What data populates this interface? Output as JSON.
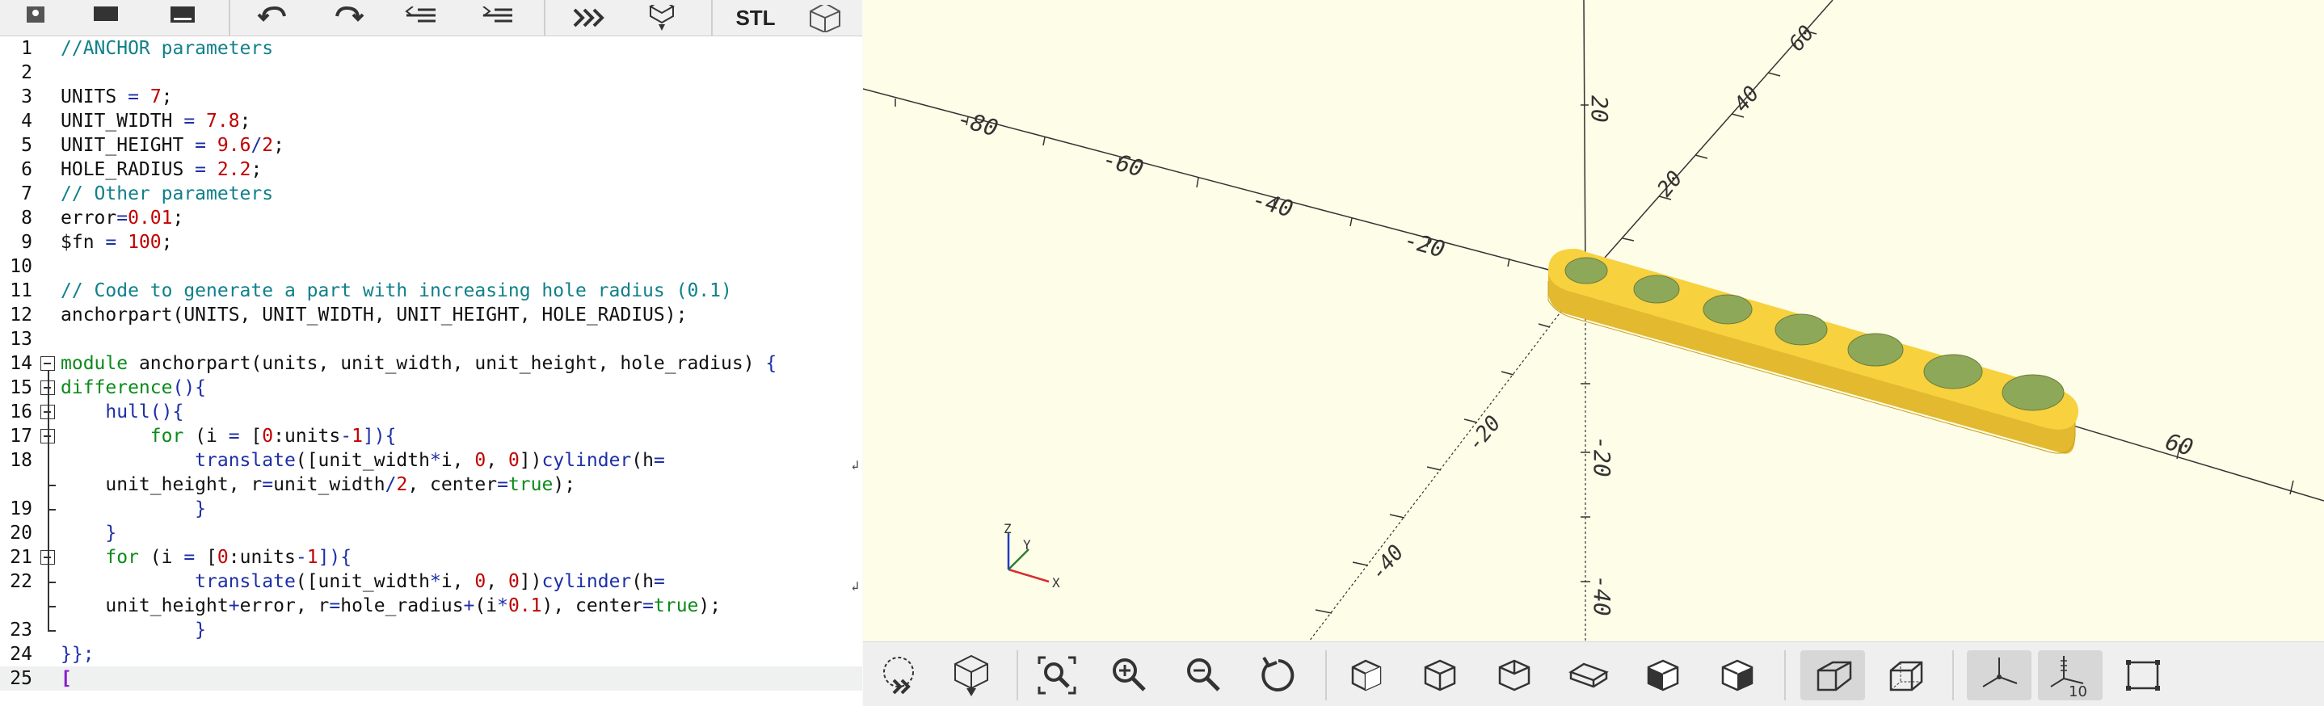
{
  "editor_toolbar": {
    "icons": [
      "new-file-icon",
      "open-file-icon",
      "save-file-icon",
      "undo-icon",
      "redo-icon",
      "unindent-icon",
      "indent-icon",
      "preview-icon",
      "render-icon",
      "export-stl-icon",
      "export-3d-icon"
    ],
    "stl_label": "STL"
  },
  "editor": {
    "lines": [
      {
        "n": "1",
        "segments": [
          [
            "//ANCHOR parameters",
            "c-com"
          ]
        ]
      },
      {
        "n": "2",
        "segments": []
      },
      {
        "n": "3",
        "segments": [
          [
            "UNITS ",
            "c-var"
          ],
          [
            "=",
            "c-op"
          ],
          [
            " ",
            "c-var"
          ],
          [
            "7",
            "c-num"
          ],
          [
            ";",
            "c-var"
          ]
        ]
      },
      {
        "n": "4",
        "segments": [
          [
            "UNIT_WIDTH ",
            "c-var"
          ],
          [
            "=",
            "c-op"
          ],
          [
            " ",
            "c-var"
          ],
          [
            "7.8",
            "c-num"
          ],
          [
            ";",
            "c-var"
          ]
        ]
      },
      {
        "n": "5",
        "segments": [
          [
            "UNIT_HEIGHT ",
            "c-var"
          ],
          [
            "=",
            "c-op"
          ],
          [
            " ",
            "c-var"
          ],
          [
            "9.6",
            "c-num"
          ],
          [
            "/",
            "c-op"
          ],
          [
            "2",
            "c-num"
          ],
          [
            ";",
            "c-var"
          ]
        ]
      },
      {
        "n": "6",
        "segments": [
          [
            "HOLE_RADIUS ",
            "c-var"
          ],
          [
            "=",
            "c-op"
          ],
          [
            " ",
            "c-var"
          ],
          [
            "2.2",
            "c-num"
          ],
          [
            ";",
            "c-var"
          ]
        ]
      },
      {
        "n": "7",
        "segments": [
          [
            "// Other parameters",
            "c-com"
          ]
        ]
      },
      {
        "n": "8",
        "segments": [
          [
            "error",
            "c-var"
          ],
          [
            "=",
            "c-op"
          ],
          [
            "0.01",
            "c-num"
          ],
          [
            ";",
            "c-var"
          ]
        ]
      },
      {
        "n": "9",
        "segments": [
          [
            "$fn ",
            "c-var"
          ],
          [
            "=",
            "c-op"
          ],
          [
            " ",
            "c-var"
          ],
          [
            "100",
            "c-num"
          ],
          [
            ";",
            "c-var"
          ]
        ]
      },
      {
        "n": "10",
        "segments": []
      },
      {
        "n": "11",
        "segments": [
          [
            "// Code to generate a part with increasing hole radius (0.1)",
            "c-com"
          ]
        ]
      },
      {
        "n": "12",
        "segments": [
          [
            "anchorpart(UNITS, UNIT_WIDTH, UNIT_HEIGHT, HOLE_RADIUS);",
            "c-var"
          ]
        ]
      },
      {
        "n": "13",
        "segments": []
      },
      {
        "n": "14",
        "segments": [
          [
            "module",
            "c-kw"
          ],
          [
            " anchorpart(units, unit_width, unit_height, hole_radius) ",
            "c-var"
          ],
          [
            "{",
            "c-br"
          ]
        ]
      },
      {
        "n": "15",
        "segments": [
          [
            "difference",
            "c-kw"
          ],
          [
            "(){",
            "c-br"
          ]
        ]
      },
      {
        "n": "16",
        "segments": [
          [
            "    ",
            "c-var"
          ],
          [
            "hull",
            "c-op"
          ],
          [
            "(){",
            "c-br"
          ]
        ]
      },
      {
        "n": "17",
        "segments": [
          [
            "        ",
            "c-var"
          ],
          [
            "for",
            "c-kw"
          ],
          [
            " (i ",
            "c-var"
          ],
          [
            "=",
            "c-op"
          ],
          [
            " [",
            "c-var"
          ],
          [
            "0",
            "c-num"
          ],
          [
            ":units",
            "c-var"
          ],
          [
            "-",
            "c-op"
          ],
          [
            "1",
            "c-num"
          ],
          [
            "]){",
            "c-br"
          ]
        ]
      },
      {
        "n": "18",
        "segments": [
          [
            "            ",
            "c-var"
          ],
          [
            "translate",
            "c-op"
          ],
          [
            "([unit_width",
            "c-var"
          ],
          [
            "*",
            "c-op"
          ],
          [
            "i, ",
            "c-var"
          ],
          [
            "0",
            "c-num"
          ],
          [
            ", ",
            "c-var"
          ],
          [
            "0",
            "c-num"
          ],
          [
            "])",
            "c-var"
          ],
          [
            "cylinder",
            "c-op"
          ],
          [
            "(h",
            "c-var"
          ],
          [
            "=",
            "c-op"
          ]
        ],
        "wrap": true
      },
      {
        "n": "",
        "segments": [
          [
            "    unit_height, r",
            "c-var"
          ],
          [
            "=",
            "c-op"
          ],
          [
            "unit_width",
            "c-var"
          ],
          [
            "/",
            "c-op"
          ],
          [
            "2",
            "c-num"
          ],
          [
            ", center",
            "c-var"
          ],
          [
            "=",
            "c-op"
          ],
          [
            "true",
            "c-bool"
          ],
          [
            ");",
            "c-var"
          ]
        ]
      },
      {
        "n": "19",
        "segments": [
          [
            "            ",
            "c-var"
          ],
          [
            "}",
            "c-br"
          ]
        ]
      },
      {
        "n": "20",
        "segments": [
          [
            "    ",
            "c-var"
          ],
          [
            "}",
            "c-br"
          ]
        ]
      },
      {
        "n": "21",
        "segments": [
          [
            "    ",
            "c-var"
          ],
          [
            "for",
            "c-kw"
          ],
          [
            " (i ",
            "c-var"
          ],
          [
            "=",
            "c-op"
          ],
          [
            " [",
            "c-var"
          ],
          [
            "0",
            "c-num"
          ],
          [
            ":units",
            "c-var"
          ],
          [
            "-",
            "c-op"
          ],
          [
            "1",
            "c-num"
          ],
          [
            "]){",
            "c-br"
          ]
        ]
      },
      {
        "n": "22",
        "segments": [
          [
            "            ",
            "c-var"
          ],
          [
            "translate",
            "c-op"
          ],
          [
            "([unit_width",
            "c-var"
          ],
          [
            "*",
            "c-op"
          ],
          [
            "i, ",
            "c-var"
          ],
          [
            "0",
            "c-num"
          ],
          [
            ", ",
            "c-var"
          ],
          [
            "0",
            "c-num"
          ],
          [
            "])",
            "c-var"
          ],
          [
            "cylinder",
            "c-op"
          ],
          [
            "(h",
            "c-var"
          ],
          [
            "=",
            "c-op"
          ]
        ],
        "wrap": true
      },
      {
        "n": "",
        "segments": [
          [
            "    unit_height",
            "c-var"
          ],
          [
            "+",
            "c-op"
          ],
          [
            "error, r",
            "c-var"
          ],
          [
            "=",
            "c-op"
          ],
          [
            "hole_radius",
            "c-var"
          ],
          [
            "+",
            "c-op"
          ],
          [
            "(i",
            "c-var"
          ],
          [
            "*",
            "c-op"
          ],
          [
            "0.1",
            "c-num"
          ],
          [
            "), center",
            "c-var"
          ],
          [
            "=",
            "c-op"
          ],
          [
            "true",
            "c-bool"
          ],
          [
            ");",
            "c-var"
          ]
        ]
      },
      {
        "n": "23",
        "segments": [
          [
            "            ",
            "c-var"
          ],
          [
            "}",
            "c-br"
          ]
        ]
      },
      {
        "n": "24",
        "segments": [
          [
            "}};",
            "c-br"
          ]
        ]
      },
      {
        "n": "25",
        "segments": [
          [
            "[",
            "c-cursor"
          ]
        ],
        "current": true
      }
    ]
  },
  "viewer": {
    "x_axis_labels": [
      "-80",
      "-60",
      "-40",
      "-20",
      "60"
    ],
    "y_axis_labels": [
      "20",
      "40",
      "60",
      "-20",
      "-40"
    ],
    "z_axis_labels": [
      "20",
      "-20",
      "-40"
    ],
    "axis_gizmo": {
      "x": "X",
      "y": "Y",
      "z": "Z"
    },
    "part_color": "#f7d13e",
    "hole_count": 7
  },
  "view_toolbar": {
    "icons": [
      "preview-animate-icon",
      "render-icon",
      "view-all-icon",
      "zoom-in-icon",
      "zoom-out-icon",
      "reset-view-icon",
      "view-right-icon",
      "view-top-icon",
      "view-bottom-icon",
      "view-left-icon",
      "view-front-icon",
      "view-back-icon",
      "perspective-icon",
      "orthogonal-icon",
      "show-axes-icon",
      "show-scale-markers-icon",
      "show-edges-icon"
    ],
    "scale_marker_label": "10"
  }
}
